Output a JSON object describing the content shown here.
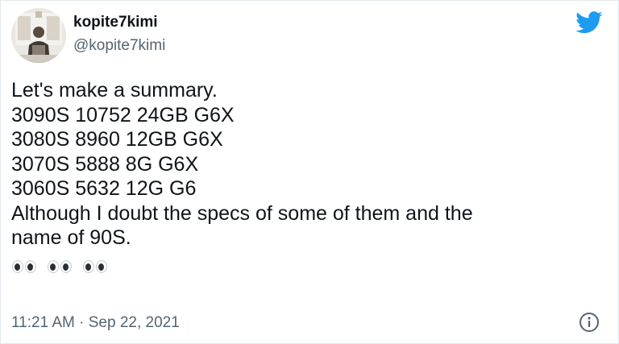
{
  "author": {
    "display_name": "kopite7kimi",
    "handle": "@kopite7kimi",
    "avatar_icon": "profile-photo"
  },
  "brand": {
    "icon": "twitter-bird-icon",
    "color": "#1d9bf0"
  },
  "tweet": {
    "lines": [
      "Let's make a summary.",
      "3090S 10752 24GB G6X",
      "3080S 8960 12GB G6X",
      "3070S 5888 8G G6X",
      "3060S 5632 12G G6",
      "Although I doubt the specs of some of them and the",
      "name of 90S."
    ],
    "emoji": [
      "eyes",
      "eyes",
      "eyes"
    ]
  },
  "footer": {
    "timestamp": "11:21 AM · Sep 22, 2021",
    "info_icon": "info-icon"
  },
  "colors": {
    "text": "#0f1419",
    "secondary_text": "#536471",
    "border": "#e1e8ed"
  }
}
